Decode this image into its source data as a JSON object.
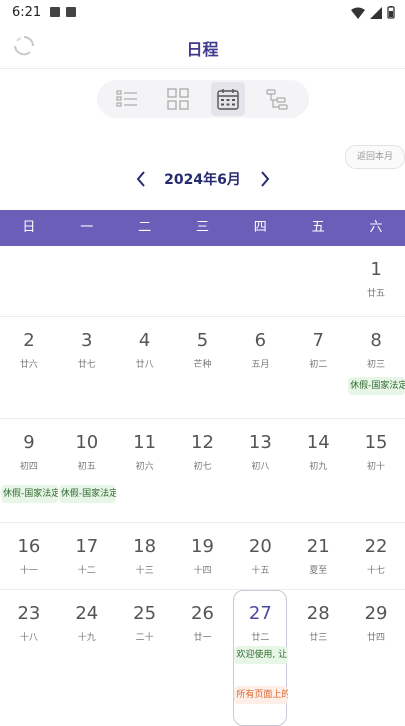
{
  "status": {
    "time": "6:21"
  },
  "app": {
    "title": "日程"
  },
  "toolbar": {
    "return_label": "返回本月"
  },
  "calendar": {
    "month_label": "2024年6月",
    "weekdays": [
      "日",
      "一",
      "二",
      "三",
      "四",
      "五",
      "六"
    ],
    "today": "27",
    "days": [
      {
        "num": "1",
        "lunar": "廿五"
      },
      {
        "num": "2",
        "lunar": "廿六"
      },
      {
        "num": "3",
        "lunar": "廿七"
      },
      {
        "num": "4",
        "lunar": "廿八"
      },
      {
        "num": "5",
        "lunar": "芒种"
      },
      {
        "num": "6",
        "lunar": "五月"
      },
      {
        "num": "7",
        "lunar": "初二"
      },
      {
        "num": "8",
        "lunar": "初三"
      },
      {
        "num": "9",
        "lunar": "初四"
      },
      {
        "num": "10",
        "lunar": "初五"
      },
      {
        "num": "11",
        "lunar": "初六"
      },
      {
        "num": "12",
        "lunar": "初七"
      },
      {
        "num": "13",
        "lunar": "初八"
      },
      {
        "num": "14",
        "lunar": "初九"
      },
      {
        "num": "15",
        "lunar": "初十"
      },
      {
        "num": "16",
        "lunar": "十一"
      },
      {
        "num": "17",
        "lunar": "十二"
      },
      {
        "num": "18",
        "lunar": "十三"
      },
      {
        "num": "19",
        "lunar": "十四"
      },
      {
        "num": "20",
        "lunar": "十五"
      },
      {
        "num": "21",
        "lunar": "夏至"
      },
      {
        "num": "22",
        "lunar": "十七"
      },
      {
        "num": "23",
        "lunar": "十八"
      },
      {
        "num": "24",
        "lunar": "十九"
      },
      {
        "num": "25",
        "lunar": "二十"
      },
      {
        "num": "26",
        "lunar": "廿一"
      },
      {
        "num": "27",
        "lunar": "廿二"
      },
      {
        "num": "28",
        "lunar": "廿三"
      },
      {
        "num": "29",
        "lunar": "廿四"
      }
    ],
    "events": {
      "holiday_8": "休假-国家法定",
      "holiday_9": "休假-国家法定",
      "holiday_10": "休假-国家法定",
      "welcome_27": "欢迎使用, 让",
      "notice_27": "所有页面上的"
    }
  }
}
